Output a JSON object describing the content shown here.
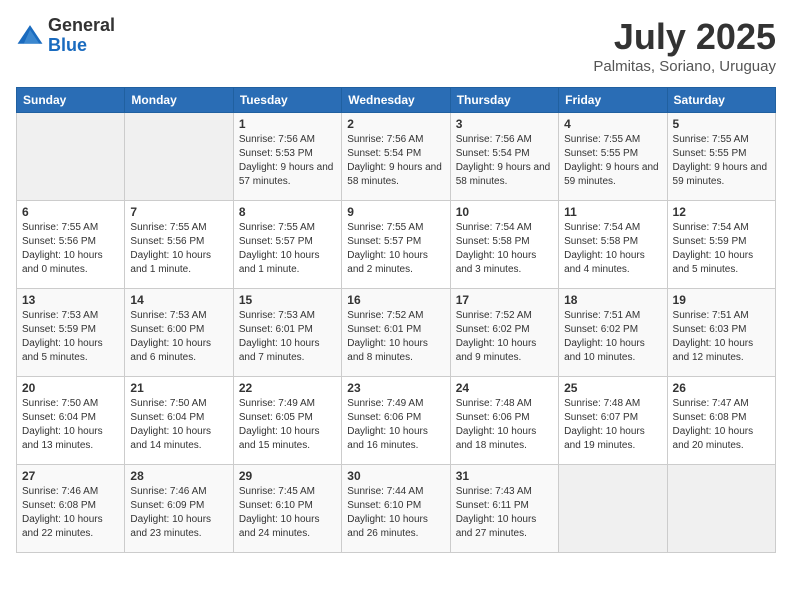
{
  "logo": {
    "general": "General",
    "blue": "Blue"
  },
  "title": "July 2025",
  "subtitle": "Palmitas, Soriano, Uruguay",
  "days_of_week": [
    "Sunday",
    "Monday",
    "Tuesday",
    "Wednesday",
    "Thursday",
    "Friday",
    "Saturday"
  ],
  "weeks": [
    [
      {
        "day": "",
        "empty": true
      },
      {
        "day": "",
        "empty": true
      },
      {
        "day": "1",
        "sunrise": "7:56 AM",
        "sunset": "5:53 PM",
        "daylight": "9 hours and 57 minutes."
      },
      {
        "day": "2",
        "sunrise": "7:56 AM",
        "sunset": "5:54 PM",
        "daylight": "9 hours and 58 minutes."
      },
      {
        "day": "3",
        "sunrise": "7:56 AM",
        "sunset": "5:54 PM",
        "daylight": "9 hours and 58 minutes."
      },
      {
        "day": "4",
        "sunrise": "7:55 AM",
        "sunset": "5:55 PM",
        "daylight": "9 hours and 59 minutes."
      },
      {
        "day": "5",
        "sunrise": "7:55 AM",
        "sunset": "5:55 PM",
        "daylight": "9 hours and 59 minutes."
      }
    ],
    [
      {
        "day": "6",
        "sunrise": "7:55 AM",
        "sunset": "5:56 PM",
        "daylight": "10 hours and 0 minutes."
      },
      {
        "day": "7",
        "sunrise": "7:55 AM",
        "sunset": "5:56 PM",
        "daylight": "10 hours and 1 minute."
      },
      {
        "day": "8",
        "sunrise": "7:55 AM",
        "sunset": "5:57 PM",
        "daylight": "10 hours and 1 minute."
      },
      {
        "day": "9",
        "sunrise": "7:55 AM",
        "sunset": "5:57 PM",
        "daylight": "10 hours and 2 minutes."
      },
      {
        "day": "10",
        "sunrise": "7:54 AM",
        "sunset": "5:58 PM",
        "daylight": "10 hours and 3 minutes."
      },
      {
        "day": "11",
        "sunrise": "7:54 AM",
        "sunset": "5:58 PM",
        "daylight": "10 hours and 4 minutes."
      },
      {
        "day": "12",
        "sunrise": "7:54 AM",
        "sunset": "5:59 PM",
        "daylight": "10 hours and 5 minutes."
      }
    ],
    [
      {
        "day": "13",
        "sunrise": "7:53 AM",
        "sunset": "5:59 PM",
        "daylight": "10 hours and 5 minutes."
      },
      {
        "day": "14",
        "sunrise": "7:53 AM",
        "sunset": "6:00 PM",
        "daylight": "10 hours and 6 minutes."
      },
      {
        "day": "15",
        "sunrise": "7:53 AM",
        "sunset": "6:01 PM",
        "daylight": "10 hours and 7 minutes."
      },
      {
        "day": "16",
        "sunrise": "7:52 AM",
        "sunset": "6:01 PM",
        "daylight": "10 hours and 8 minutes."
      },
      {
        "day": "17",
        "sunrise": "7:52 AM",
        "sunset": "6:02 PM",
        "daylight": "10 hours and 9 minutes."
      },
      {
        "day": "18",
        "sunrise": "7:51 AM",
        "sunset": "6:02 PM",
        "daylight": "10 hours and 10 minutes."
      },
      {
        "day": "19",
        "sunrise": "7:51 AM",
        "sunset": "6:03 PM",
        "daylight": "10 hours and 12 minutes."
      }
    ],
    [
      {
        "day": "20",
        "sunrise": "7:50 AM",
        "sunset": "6:04 PM",
        "daylight": "10 hours and 13 minutes."
      },
      {
        "day": "21",
        "sunrise": "7:50 AM",
        "sunset": "6:04 PM",
        "daylight": "10 hours and 14 minutes."
      },
      {
        "day": "22",
        "sunrise": "7:49 AM",
        "sunset": "6:05 PM",
        "daylight": "10 hours and 15 minutes."
      },
      {
        "day": "23",
        "sunrise": "7:49 AM",
        "sunset": "6:06 PM",
        "daylight": "10 hours and 16 minutes."
      },
      {
        "day": "24",
        "sunrise": "7:48 AM",
        "sunset": "6:06 PM",
        "daylight": "10 hours and 18 minutes."
      },
      {
        "day": "25",
        "sunrise": "7:48 AM",
        "sunset": "6:07 PM",
        "daylight": "10 hours and 19 minutes."
      },
      {
        "day": "26",
        "sunrise": "7:47 AM",
        "sunset": "6:08 PM",
        "daylight": "10 hours and 20 minutes."
      }
    ],
    [
      {
        "day": "27",
        "sunrise": "7:46 AM",
        "sunset": "6:08 PM",
        "daylight": "10 hours and 22 minutes."
      },
      {
        "day": "28",
        "sunrise": "7:46 AM",
        "sunset": "6:09 PM",
        "daylight": "10 hours and 23 minutes."
      },
      {
        "day": "29",
        "sunrise": "7:45 AM",
        "sunset": "6:10 PM",
        "daylight": "10 hours and 24 minutes."
      },
      {
        "day": "30",
        "sunrise": "7:44 AM",
        "sunset": "6:10 PM",
        "daylight": "10 hours and 26 minutes."
      },
      {
        "day": "31",
        "sunrise": "7:43 AM",
        "sunset": "6:11 PM",
        "daylight": "10 hours and 27 minutes."
      },
      {
        "day": "",
        "empty": true
      },
      {
        "day": "",
        "empty": true
      }
    ]
  ],
  "labels": {
    "sunrise": "Sunrise:",
    "sunset": "Sunset:",
    "daylight": "Daylight:"
  }
}
